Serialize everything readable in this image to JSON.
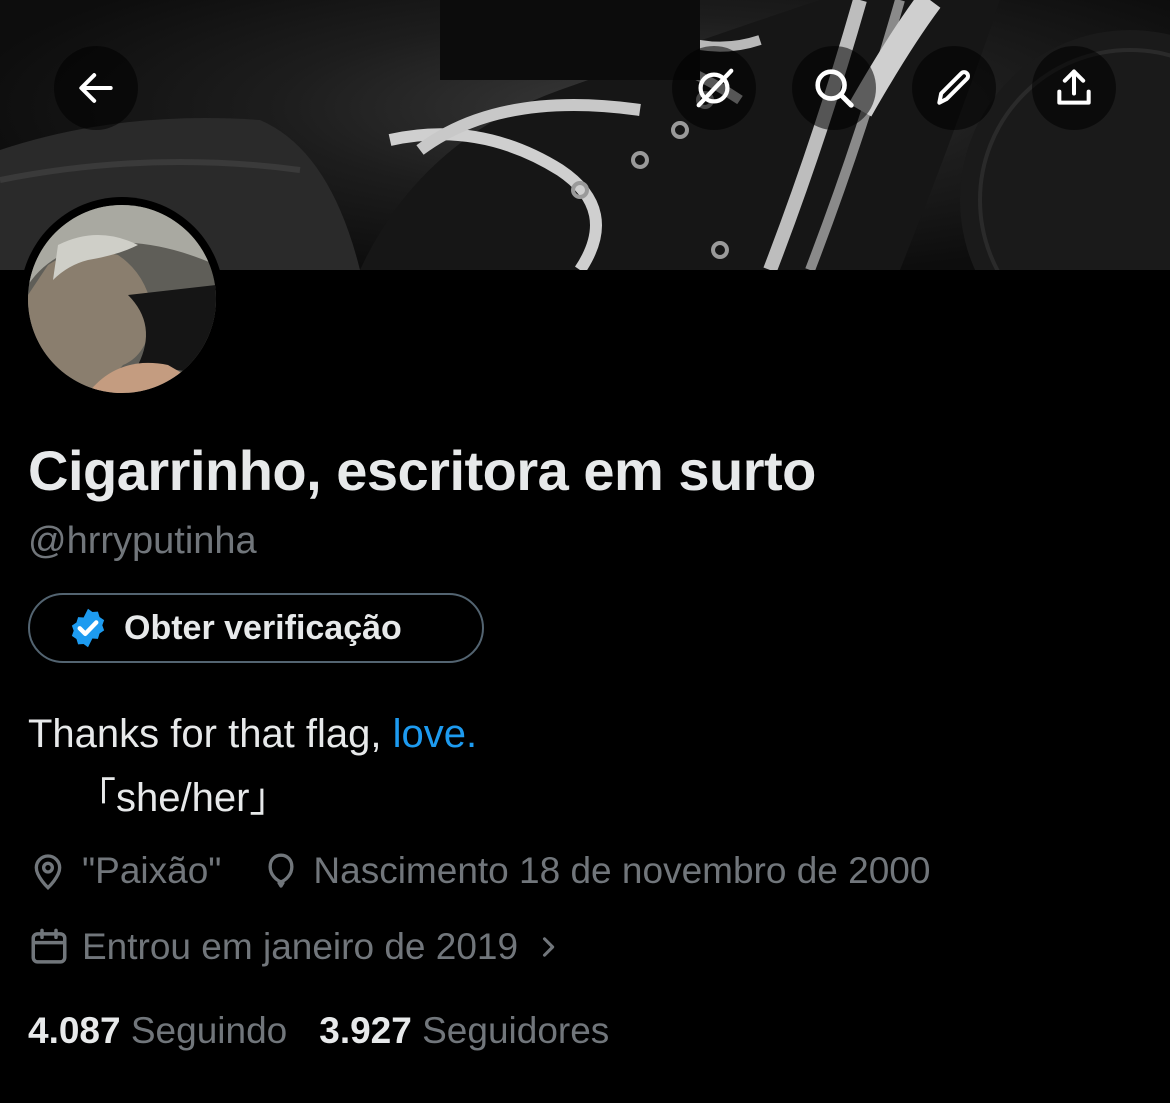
{
  "profile": {
    "display_name": "Cigarrinho, escritora em surto",
    "handle": "@hrryputinha",
    "verify_label": "Obter verificação",
    "bio_text": "Thanks for that flag, ",
    "bio_link": "love.",
    "bio_line2": "「she/her」",
    "location": "\"Paixão\"",
    "birthday": "Nascimento 18 de novembro de 2000",
    "joined": "Entrou em janeiro de 2019",
    "following_count": "4.087",
    "following_label": "Seguindo",
    "followers_count": "3.927",
    "followers_label": "Seguidores"
  },
  "icons": {
    "back": "back-arrow-icon",
    "grok": "grok-icon",
    "search": "search-icon",
    "edit": "pencil-icon",
    "share": "share-icon",
    "verified": "verified-badge-icon",
    "location": "location-pin-icon",
    "birthday": "balloon-icon",
    "calendar": "calendar-icon",
    "chevron": "chevron-right-icon"
  },
  "colors": {
    "background": "#000000",
    "text": "#e7e9ea",
    "secondary": "#71767b",
    "accent": "#1d9bf0",
    "border": "#536471"
  }
}
